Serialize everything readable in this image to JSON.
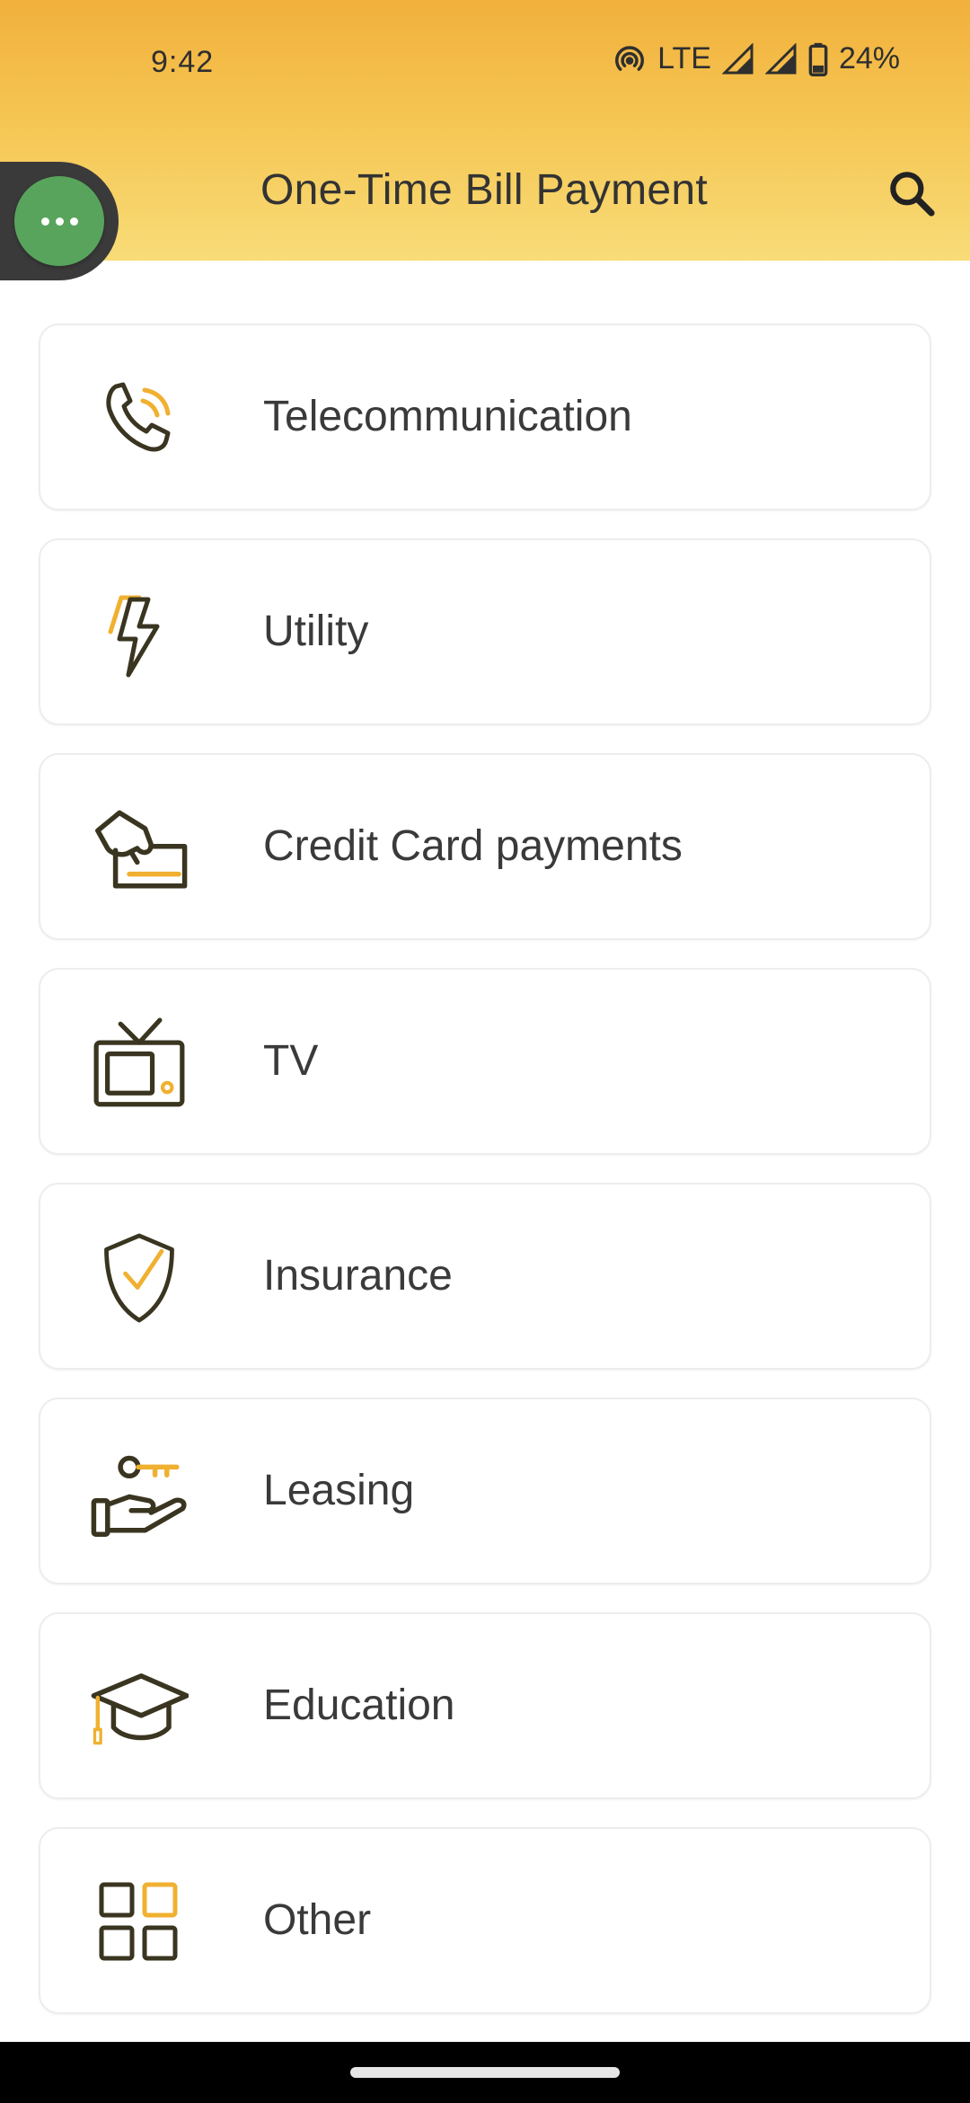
{
  "status_bar": {
    "time": "9:42",
    "network": "LTE",
    "battery": "24%"
  },
  "app_bar": {
    "title": "One-Time Bill Payment",
    "search_icon": "search-icon"
  },
  "bubble": {
    "icon": "more-horizontal-icon",
    "color": "#58a45c"
  },
  "categories": [
    {
      "label": "Telecommunication",
      "icon": "phone-icon"
    },
    {
      "label": "Utility",
      "icon": "lightning-icon"
    },
    {
      "label": "Credit Card payments",
      "icon": "credit-card-hand-icon"
    },
    {
      "label": "TV",
      "icon": "tv-icon"
    },
    {
      "label": "Insurance",
      "icon": "shield-check-icon"
    },
    {
      "label": "Leasing",
      "icon": "hand-key-icon"
    },
    {
      "label": "Education",
      "icon": "graduation-cap-icon"
    },
    {
      "label": "Other",
      "icon": "grid-icon"
    }
  ],
  "colors": {
    "accent": "#f2b03c",
    "icon_dark": "#3a3520",
    "icon_accent": "#f0b030"
  }
}
